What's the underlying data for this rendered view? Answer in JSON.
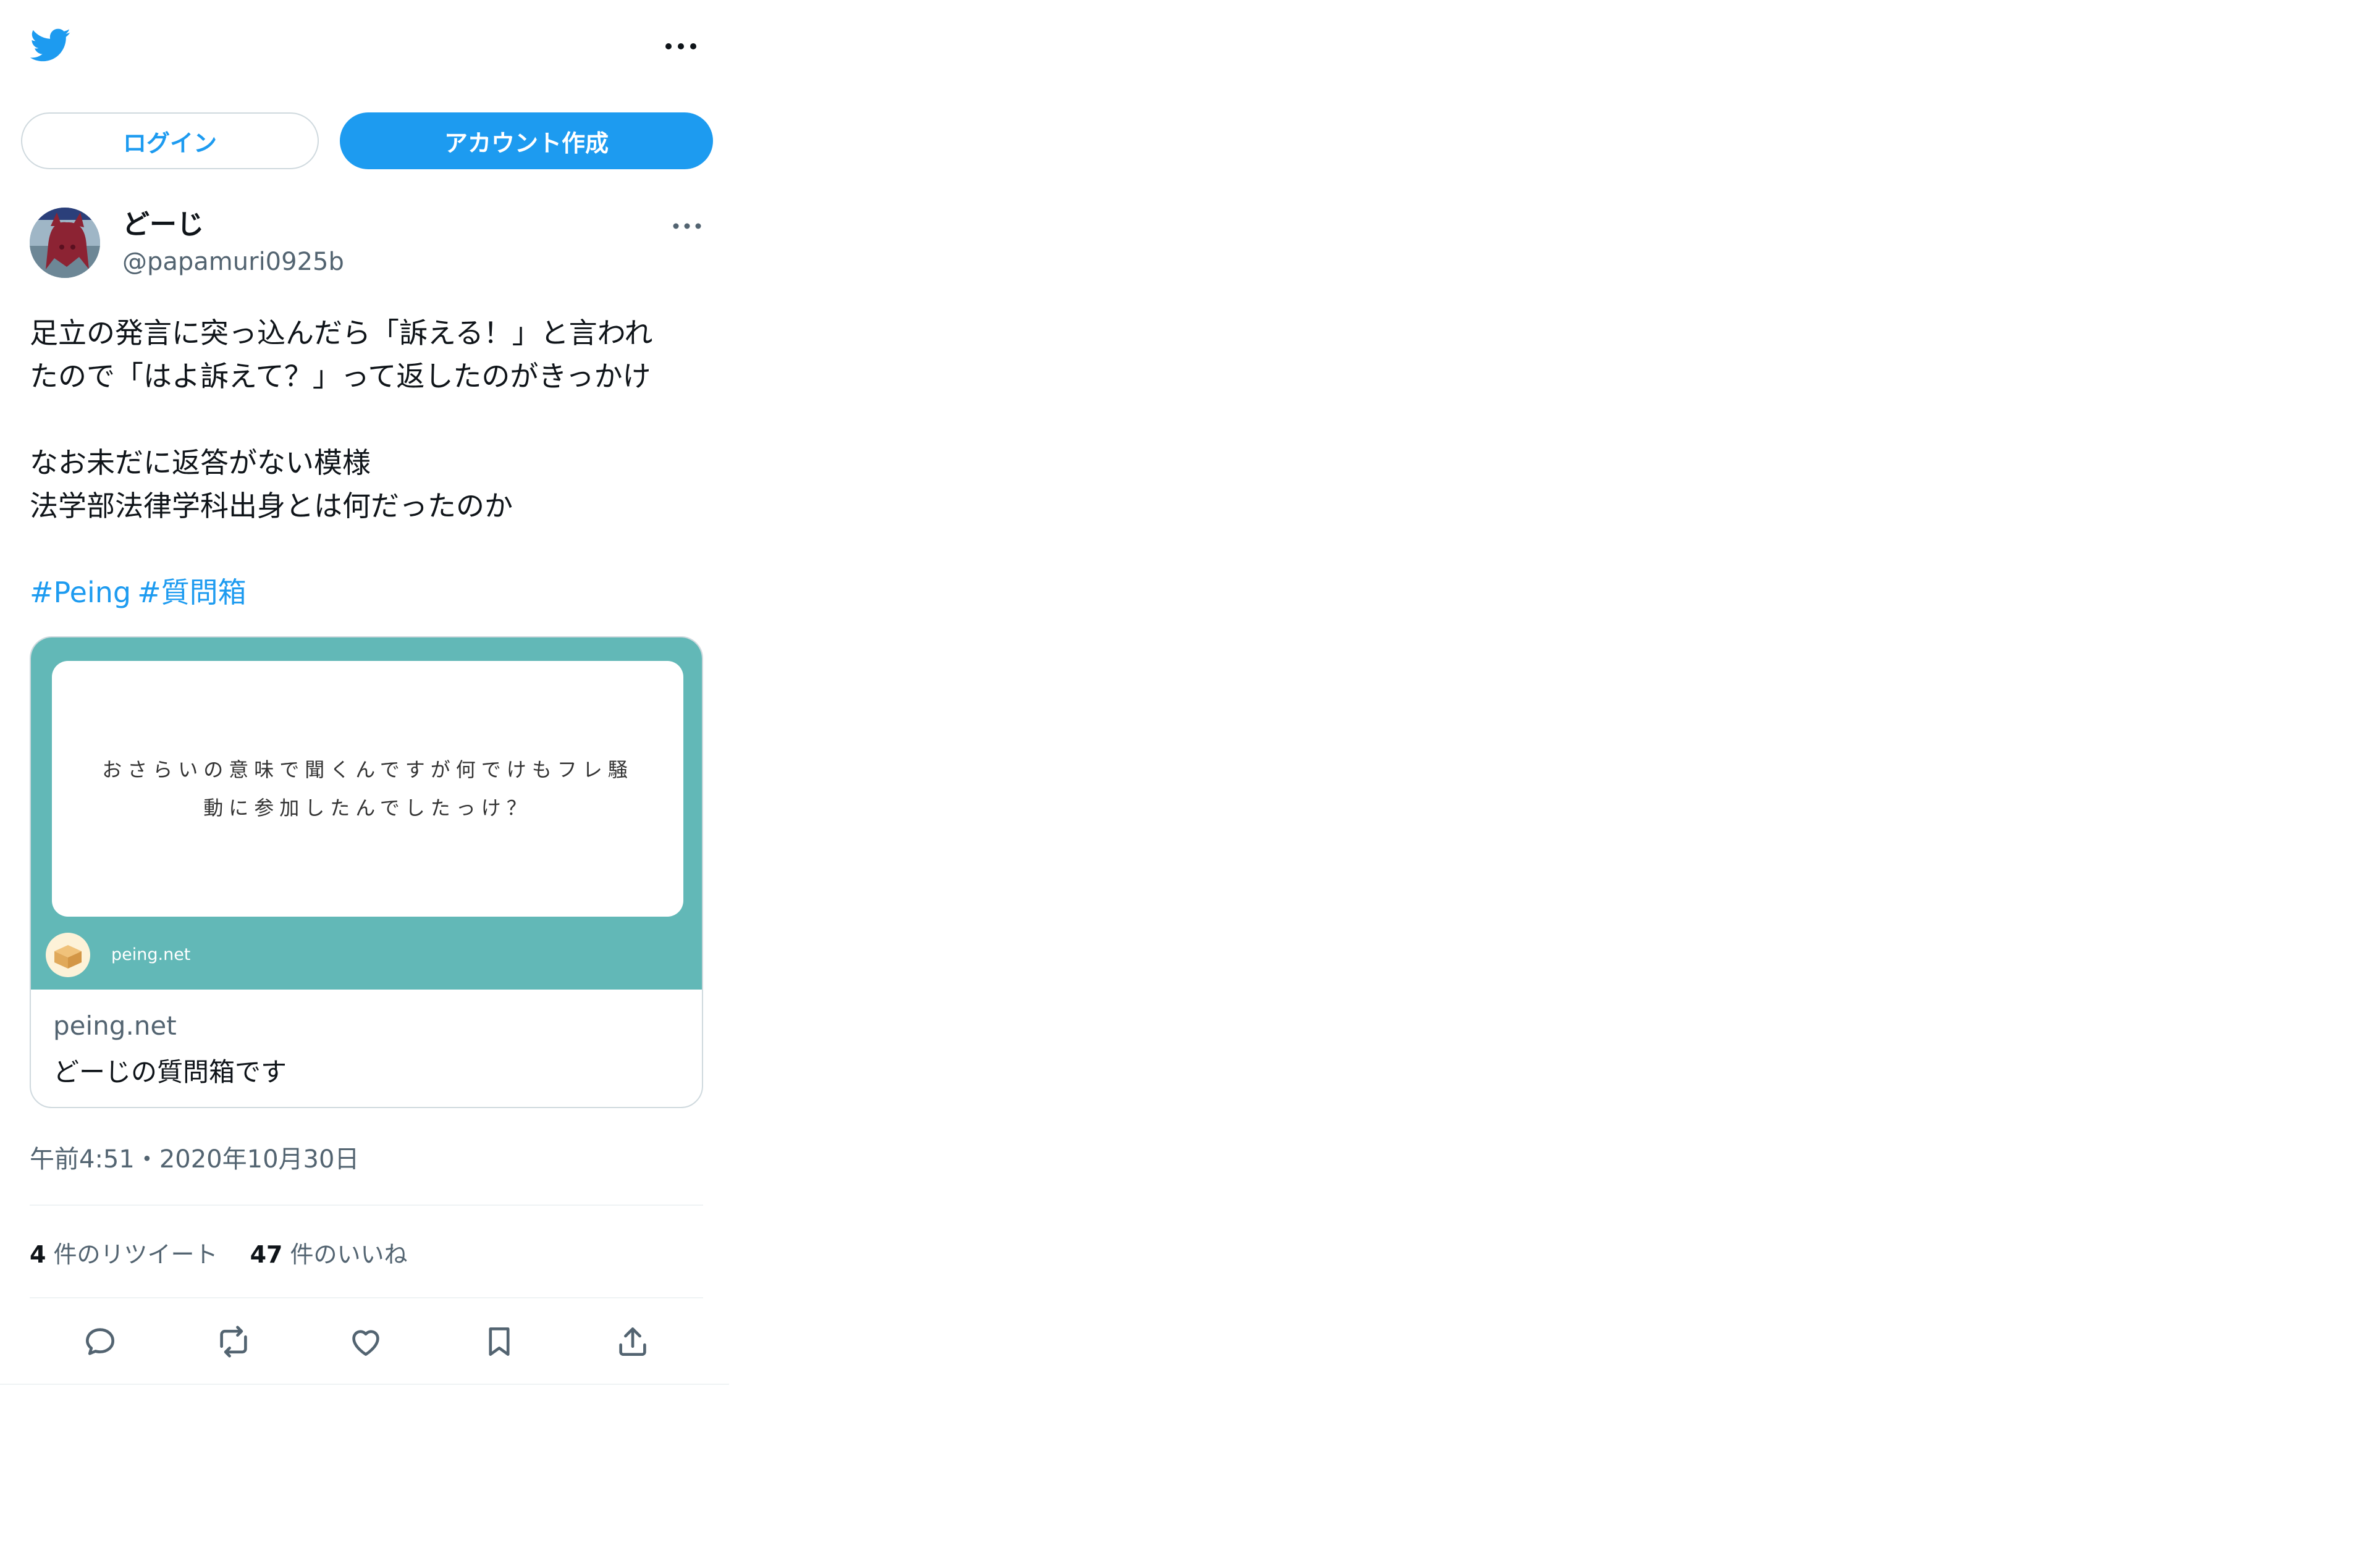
{
  "header": {
    "logo_icon": "twitter-bird-icon",
    "more_icon": "more-horizontal-icon"
  },
  "auth": {
    "login_label": "ログイン",
    "signup_label": "アカウント作成"
  },
  "tweet": {
    "author": {
      "name": "どーじ",
      "handle": "@papamuri0925b",
      "avatar_icon": "user-avatar"
    },
    "text_lines": [
      "足立の発言に突っ込んだら「訴える！」と言われ",
      "たので「はよ訴えて？」って返したのがきっかけ",
      "",
      "なお未だに返答がない模様",
      "法学部法律学科出身とは何だったのか"
    ],
    "hashtags": [
      "#Peing",
      "#質問箱"
    ],
    "card": {
      "question_lines": [
        "おさらいの意味で聞くんですが何でけもフレ騒",
        "動に参加したんでしたっけ？"
      ],
      "media_site": "peing.net",
      "domain": "peing.net",
      "description": "どーじの質問箱です"
    },
    "timestamp": "午前4:51・2020年10月30日",
    "stats": {
      "retweet_count": "4",
      "retweet_label": "件のリツイート",
      "like_count": "47",
      "like_label": "件のいいね"
    },
    "actions": [
      "reply-icon",
      "retweet-icon",
      "like-icon",
      "bookmark-icon",
      "share-icon"
    ]
  },
  "colors": {
    "accent": "#1d9bf0",
    "card_teal": "#62b8b7",
    "secondary_text": "#536471"
  }
}
